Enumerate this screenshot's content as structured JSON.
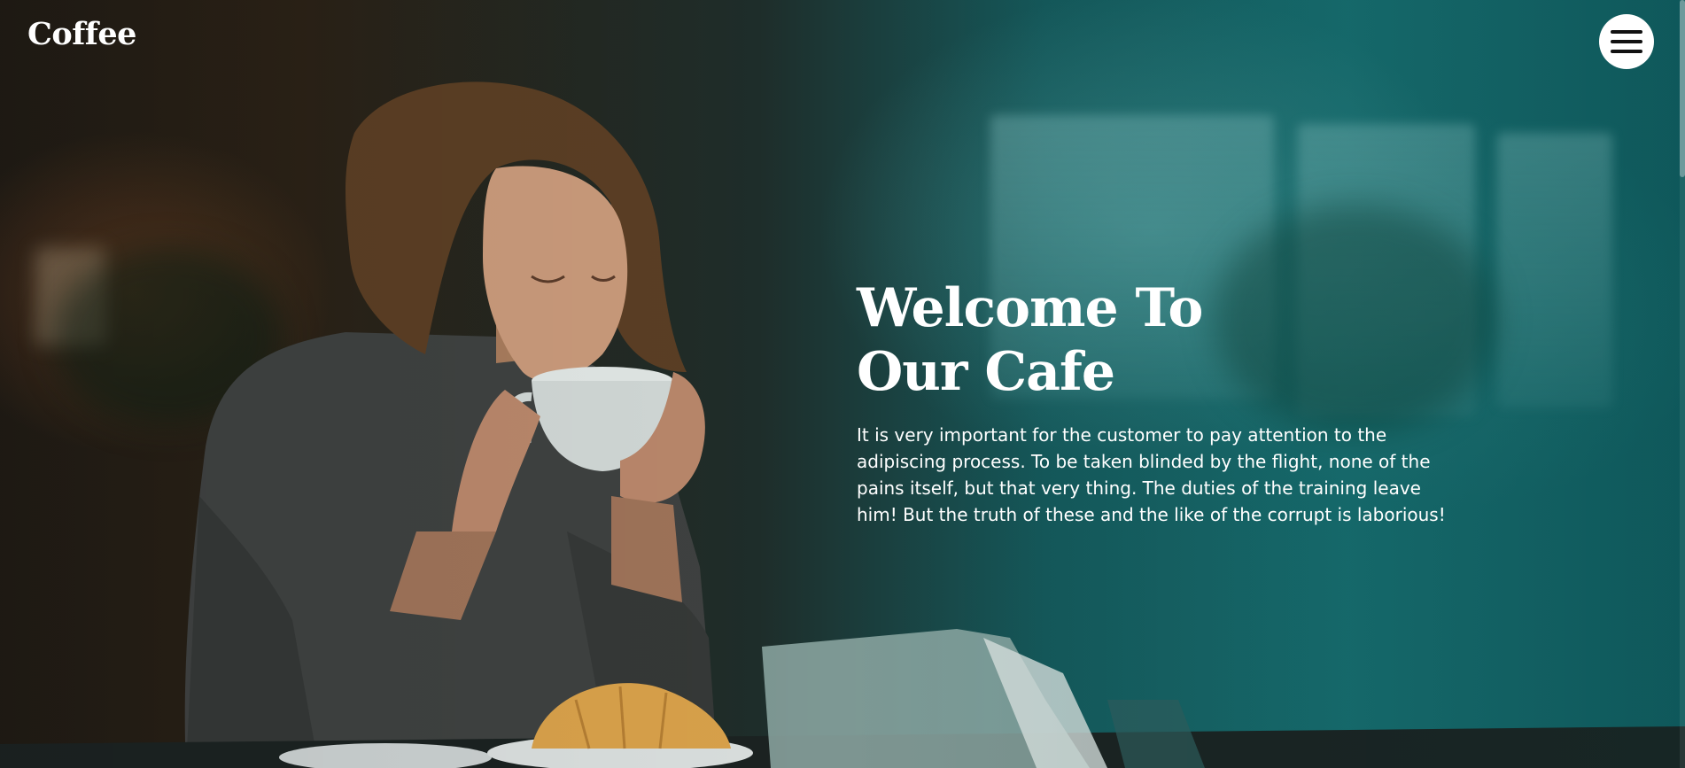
{
  "header": {
    "brand": "Coffee",
    "menu_icon": "hamburger-menu-icon"
  },
  "hero": {
    "title_line1": "Welcome To",
    "title_line2": "Our Cafe",
    "description": "It is very important for the customer to pay attention to the adipiscing process. To be taken blinded by the flight, none of the pains itself, but that very thing. The duties of the training leave him! But the truth of these and the like of the corrupt is laborious!"
  },
  "colors": {
    "overlay_teal": "#176c6e",
    "text": "#ffffff",
    "menu_button_bg": "#ffffff"
  }
}
